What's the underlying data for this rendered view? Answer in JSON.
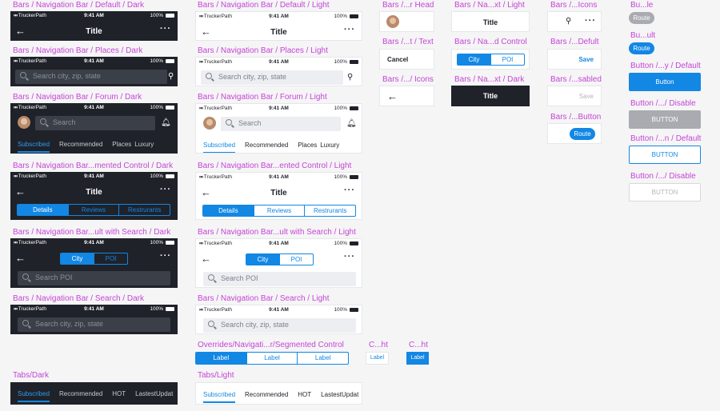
{
  "status": {
    "carrier": "TruckerPath",
    "time": "9:41 AM",
    "battery": "100%"
  },
  "left": {
    "default_dark": {
      "label": "Bars / Navigation Bar / Default / Dark",
      "title": "Title"
    },
    "places_dark": {
      "label": "Bars / Navigation Bar / Places / Dark",
      "placeholder": "Search city, zip, state"
    },
    "forum_dark": {
      "label": "Bars / Navigation Bar / Forum / Dark",
      "placeholder": "Search",
      "tabs": [
        "Subscribed",
        "Recommended",
        "Places",
        "Luxury"
      ]
    },
    "segmented_dark": {
      "label": "Bars / Navigation Bar...mented Control / Dark",
      "title": "Title",
      "segments": [
        "Details",
        "Reviews",
        "Restrurants"
      ]
    },
    "result_search_dark": {
      "label": "Bars / Navigation Bar...ult with Search / Dark",
      "segments": [
        "City",
        "POI"
      ],
      "placeholder": "Search POI"
    },
    "search_dark": {
      "label": "Bars / Navigation Bar / Search / Dark",
      "placeholder": "Search city, zip, state"
    },
    "tabs_dark": {
      "label": "Tabs/Dark",
      "tabs": [
        "Subscribed",
        "Recommended",
        "HOT",
        "LastestUpdat"
      ]
    }
  },
  "mid": {
    "default_light": {
      "label": "Bars / Navigation Bar / Default / Light",
      "title": "Title"
    },
    "places_light": {
      "label": "Bars / Navigation Bar / Places / Light",
      "placeholder": "Search city, zip, state"
    },
    "forum_light": {
      "label": "Bars / Navigation Bar / Forum / Light",
      "placeholder": "Search",
      "tabs": [
        "Subscribed",
        "Recommended",
        "Places",
        "Luxury"
      ]
    },
    "segmented_light": {
      "label": "Bars / Navigation Bar...ented Control / Light",
      "title": "Title",
      "segments": [
        "Details",
        "Reviews",
        "Restrurants"
      ]
    },
    "result_search_light": {
      "label": "Bars / Navigation Bar...ult with Search / Light",
      "segments": [
        "City",
        "POI"
      ],
      "placeholder": "Search POI"
    },
    "search_light": {
      "label": "Bars / Navigation Bar / Search / Light",
      "placeholder": "Search city, zip, state"
    },
    "overrides": {
      "label": "Overrides/Navigati...r/Segmented Control",
      "segments": [
        "Label",
        "Label",
        "Label"
      ]
    },
    "c_light": {
      "label": "C...ht",
      "text": "Label"
    },
    "c_dark": {
      "label": "C...ht",
      "text": "Label"
    },
    "tabs_light": {
      "label": "Tabs/Light",
      "tabs": [
        "Subscribed",
        "Recommended",
        "HOT",
        "LastestUpdat"
      ]
    }
  },
  "components": {
    "head": {
      "label": "Bars /...r Head"
    },
    "text": {
      "label": "Bars /...t / Text",
      "value": "Cancel"
    },
    "icons": {
      "label": "Bars /.../ Icons"
    },
    "title_light": {
      "label": "Bars / Na...xt  / Light",
      "value": "Title"
    },
    "seg_control": {
      "label": "Bars / Na...d Control",
      "segments": [
        "City",
        "POI"
      ]
    },
    "title_dark": {
      "label": "Bars / Na...xt  / Dark",
      "value": "Title"
    },
    "right_icons": {
      "label": "Bars /...Icons"
    },
    "save_default": {
      "label": "Bars /...Defult",
      "value": "Save"
    },
    "save_disabled": {
      "label": "Bars /...sabled",
      "value": "Save"
    },
    "route_button": {
      "label": "Bars /...Button",
      "value": "Route"
    }
  },
  "buttons": {
    "pill_disabled": {
      "label": "Bu...le",
      "value": "Route"
    },
    "pill_default": {
      "label": "Bu...ult",
      "value": "Route"
    },
    "primary_default": {
      "label": "Button /...y / Default",
      "value": "Button"
    },
    "primary_disabled": {
      "label": "Button /.../ Disable",
      "value": "BUTTON"
    },
    "outline_default": {
      "label": "Button /...n / Default",
      "value": "BUTTON"
    },
    "outline_disabled": {
      "label": "Button /.../ Disable",
      "value": "BUTTON"
    }
  },
  "colors": {
    "accent": "#1287e4",
    "dark_bg": "#1f2229",
    "label_pink": "#c644d6",
    "disabled_gray": "#a9abb0"
  }
}
